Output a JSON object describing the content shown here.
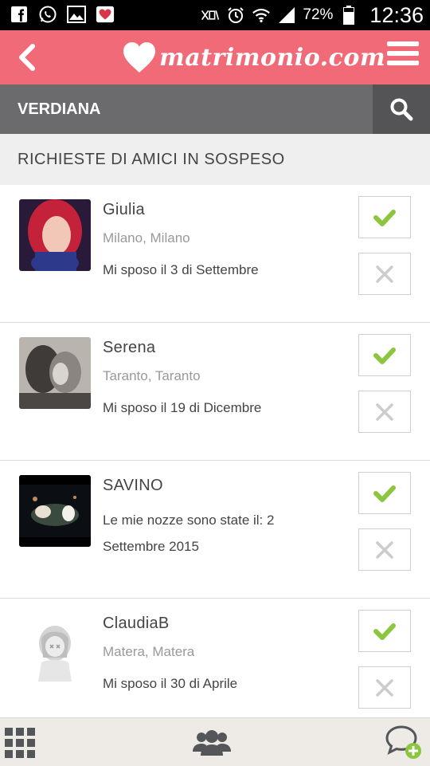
{
  "status_bar": {
    "battery_percent": "72%",
    "time": "12:36"
  },
  "header": {
    "logo_text": "matrimonio.com"
  },
  "user_bar": {
    "name": "VERDIANA"
  },
  "section": {
    "title": "RICHIESTE DI AMICI IN SOSPESO"
  },
  "requests": [
    {
      "name": "Giulia",
      "location": "Milano, Milano",
      "wedding": "Mi sposo il 3 di Settembre"
    },
    {
      "name": "Serena",
      "location": "Taranto, Taranto",
      "wedding": "Mi sposo il 19 di Dicembre"
    },
    {
      "name": "SAVINO",
      "location": "",
      "wedding": "Le mie nozze sono state il: 2 Settembre 2015"
    },
    {
      "name": "ClaudiaB",
      "location": "Matera, Matera",
      "wedding": "Mi sposo il 30 di Aprile"
    }
  ],
  "colors": {
    "accent": "#f06a78",
    "user_bar": "#6b6a6d",
    "check": "#8cc63f"
  }
}
